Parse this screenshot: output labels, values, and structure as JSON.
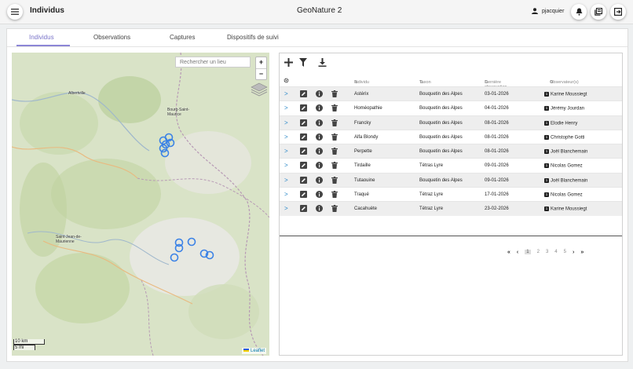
{
  "header": {
    "app_title": "Individus",
    "center_title": "GeoNature 2",
    "username": "pjacquier"
  },
  "tabs": [
    {
      "label": "Individus",
      "active": true
    },
    {
      "label": "Observations",
      "active": false
    },
    {
      "label": "Captures",
      "active": false
    },
    {
      "label": "Dispositifs de suivi",
      "active": false
    }
  ],
  "map": {
    "search_placeholder": "Rechercher un lieu",
    "zoom_in": "+",
    "zoom_out": "−",
    "scale_km": "10 km",
    "scale_mi": "5 mi",
    "attribution": "Leaflet",
    "places": [
      {
        "label": "Albertville"
      },
      {
        "label": "Bourg-Saint-Maurice"
      },
      {
        "label": "Saint-Jean-de-Maurienne"
      }
    ],
    "marker_color": "#3b82e6"
  },
  "table": {
    "columns": [
      "Individu",
      "Taxon",
      "Dernière observation",
      "Observateur(s)"
    ],
    "rows": [
      {
        "individu": "Astérix",
        "taxon": "Bouquetin des Alpes",
        "date": "03-01-2026",
        "badge": "1",
        "observateur": "Karine Moussiegt"
      },
      {
        "individu": "Homéopathie",
        "taxon": "Bouquetin des Alpes",
        "date": "04-01-2026",
        "badge": "1",
        "observateur": "Jérémy Jourdan"
      },
      {
        "individu": "Francky",
        "taxon": "Bouquetin des Alpes",
        "date": "08-01-2026",
        "badge": "1",
        "observateur": "Elodie Henry"
      },
      {
        "individu": "Alfa Blondy",
        "taxon": "Bouquetin des Alpes",
        "date": "08-01-2026",
        "badge": "1",
        "observateur": "Christophe Gotti"
      },
      {
        "individu": "Perpette",
        "taxon": "Bouquetin des Alpes",
        "date": "08-01-2026",
        "badge": "1",
        "observateur": "Joël Blanchemain"
      },
      {
        "individu": "Tirdaille",
        "taxon": "Tétras Lyre",
        "date": "09-01-2026",
        "badge": "1",
        "observateur": "Nicolas Gomez"
      },
      {
        "individu": "Tutaouine",
        "taxon": "Bouquetin des Alpes",
        "date": "09-01-2026",
        "badge": "1",
        "observateur": "Joël Blanchemain"
      },
      {
        "individu": "Traqué",
        "taxon": "Tétraz Lyre",
        "date": "17-01-2026",
        "badge": "1",
        "observateur": "Nicolas Gomez"
      },
      {
        "individu": "Cacahuète",
        "taxon": "Tétraz Lyre",
        "date": "23-02-2026",
        "badge": "1",
        "observateur": "Karine Moussiegt"
      }
    ]
  },
  "pager": {
    "first": "«",
    "prev": "‹",
    "pages": [
      "1",
      "2",
      "3",
      "4",
      "5"
    ],
    "current": "1",
    "next": "›",
    "last": "»"
  }
}
